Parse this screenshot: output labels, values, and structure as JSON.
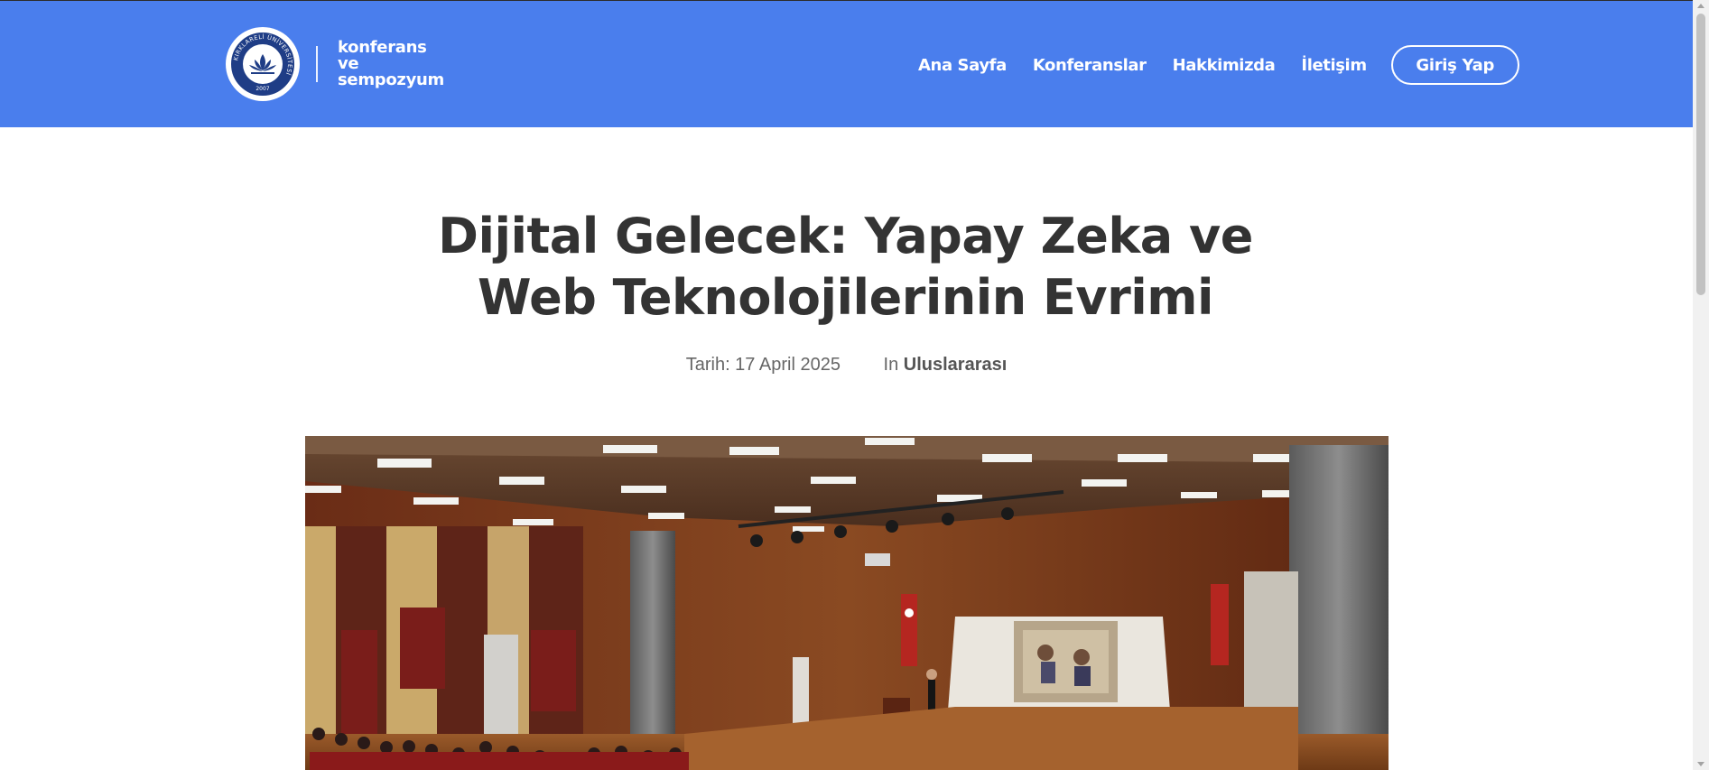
{
  "header": {
    "background_color": "#4a7eed",
    "logo": {
      "seal_ring_text": "KIRKLARELİ ÜNİVERSİTESİ",
      "seal_year": "2007",
      "text_lines": [
        "konferans",
        "ve",
        "sempozyum"
      ]
    },
    "nav": {
      "items": [
        {
          "label": "Ana Sayfa"
        },
        {
          "label": "Konferanslar"
        },
        {
          "label": "Hakkimizda"
        },
        {
          "label": "İletişim"
        }
      ],
      "login_label": "Giriş Yap"
    }
  },
  "article": {
    "title_lines": [
      "Dijital Gelecek: Yapay Zeka ve",
      "Web Teknolojilerinin Evrimi"
    ],
    "date_label": "Tarih: 17 April 2025",
    "category_prefix": "In",
    "category": "Uluslararası",
    "hero_image": "auditorium-photo"
  },
  "colors": {
    "title": "#333333",
    "meta": "#666666",
    "header": "#4a7eed"
  }
}
